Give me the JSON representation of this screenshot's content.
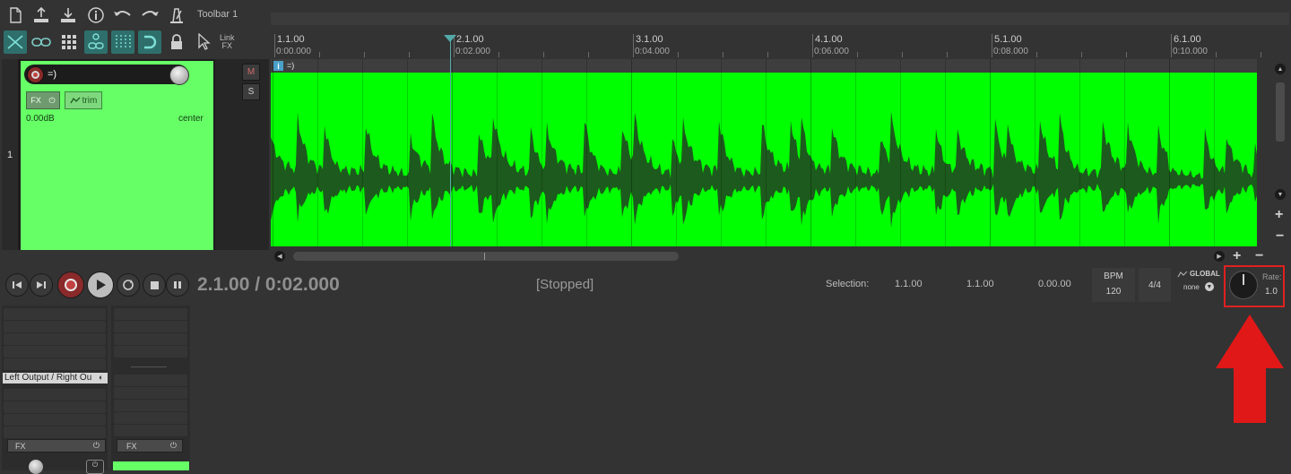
{
  "toolbar": {
    "title": "Toolbar 1",
    "link_fx": [
      "Link",
      "FX"
    ],
    "icons_row1": [
      "new-file-icon",
      "upload-icon",
      "download-icon",
      "info-icon",
      "undo-icon",
      "redo-icon",
      "metronome-icon"
    ],
    "icons_row2": [
      "crossfade-icon",
      "link-icon",
      "grid-icon",
      "group-link-icon",
      "snap-grid-icon",
      "magnet-icon",
      "lock-icon",
      "cursor-icon"
    ]
  },
  "ruler": {
    "marks": [
      {
        "bar": "1.1.00",
        "time": "0:00.000"
      },
      {
        "bar": "2.1.00",
        "time": "0:02.000"
      },
      {
        "bar": "3.1.00",
        "time": "0:04.000"
      },
      {
        "bar": "4.1.00",
        "time": "0:06.000"
      },
      {
        "bar": "5.1.00",
        "time": "0:08.000"
      },
      {
        "bar": "6.1.00",
        "time": "0:10.000"
      }
    ]
  },
  "track": {
    "number": "1",
    "name": "=)",
    "fx_label": "FX",
    "trim_label": "trim",
    "volume": "0.00dB",
    "pan": "center",
    "mute_label": "M",
    "solo_label": "S",
    "color": "#66ff66"
  },
  "item": {
    "info_label": "i",
    "title": "=)",
    "color": "#00ff00",
    "wave_color": "#1d5a1d"
  },
  "transport": {
    "time_display": "2.1.00 / 0:02.000",
    "status": "[Stopped]",
    "selection_label": "Selection:",
    "selection_start": "1.1.00",
    "selection_end": "1.1.00",
    "selection_length": "0.00.00",
    "bpm_label": "BPM",
    "bpm_value": "120",
    "time_signature": "4/4",
    "global_label": "GLOBAL",
    "global_value": "none",
    "rate_label": "Rate:",
    "rate_value": "1.0"
  },
  "mixer": {
    "io_label": "Left Output / Right Ou",
    "fx_label_1": "FX",
    "fx_label_2": "FX"
  },
  "annotation": {
    "highlight_color": "#e02020"
  }
}
